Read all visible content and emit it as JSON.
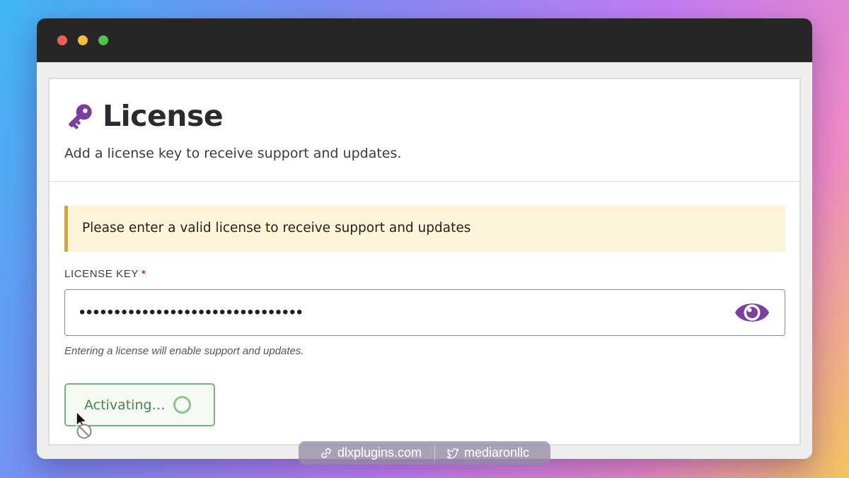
{
  "colors": {
    "accent": "#7b3f9e",
    "notice_bg": "#fdf3d8",
    "notice_border": "#dba523",
    "button_border": "#76b57a",
    "button_text": "#4f8054"
  },
  "window": {
    "controls": [
      "close",
      "minimize",
      "maximize"
    ]
  },
  "header": {
    "icon": "key-icon",
    "title": "License",
    "subtitle": "Add a license key to receive support and updates."
  },
  "notice": {
    "text": "Please enter a valid license to receive support and updates"
  },
  "license_field": {
    "label": "LICENSE KEY",
    "required_mark": "*",
    "masked_value": "••••••••••••••••••••••••••••••••",
    "toggle_icon": "eye-icon",
    "help_text": "Entering a license will enable support and updates."
  },
  "activate_button": {
    "label": "Activating…",
    "state": "loading",
    "icon": "spinner-icon"
  },
  "cursor": {
    "icon": "not-allowed-cursor-icon"
  },
  "watermark": {
    "website": "dlxplugins.com",
    "website_icon": "link-icon",
    "twitter": "mediaronllc",
    "twitter_icon": "twitter-icon"
  }
}
